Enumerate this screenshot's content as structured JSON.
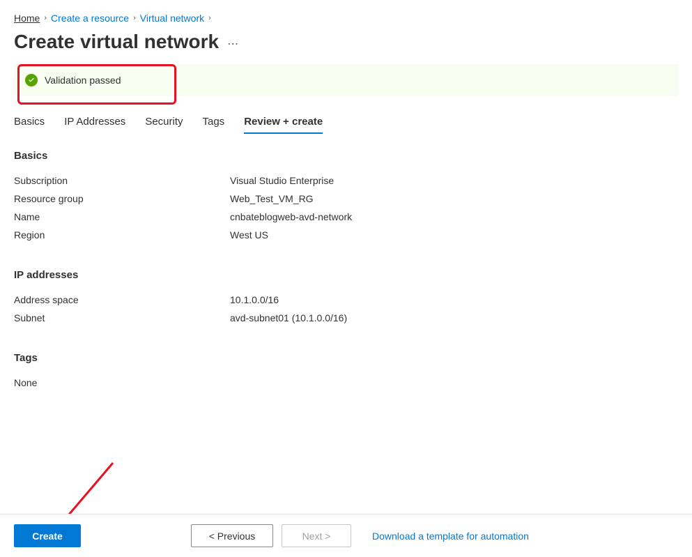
{
  "breadcrumb": {
    "home": "Home",
    "create_resource": "Create a resource",
    "virtual_network": "Virtual network"
  },
  "page": {
    "title": "Create virtual network"
  },
  "validation": {
    "message": "Validation passed"
  },
  "tabs": {
    "basics": "Basics",
    "ip_addresses": "IP Addresses",
    "security": "Security",
    "tags": "Tags",
    "review_create": "Review + create"
  },
  "sections": {
    "basics": {
      "title": "Basics",
      "rows": {
        "subscription_label": "Subscription",
        "subscription_value": "Visual Studio Enterprise",
        "resource_group_label": "Resource group",
        "resource_group_value": "Web_Test_VM_RG",
        "name_label": "Name",
        "name_value": "cnbateblogweb-avd-network",
        "region_label": "Region",
        "region_value": "West US"
      }
    },
    "ip": {
      "title": "IP addresses",
      "rows": {
        "address_space_label": "Address space",
        "address_space_value": "10.1.0.0/16",
        "subnet_label": "Subnet",
        "subnet_value": "avd-subnet01 (10.1.0.0/16)"
      }
    },
    "tags": {
      "title": "Tags",
      "none": "None"
    }
  },
  "footer": {
    "create": "Create",
    "previous": "< Previous",
    "next": "Next >",
    "download_template": "Download a template for automation"
  }
}
